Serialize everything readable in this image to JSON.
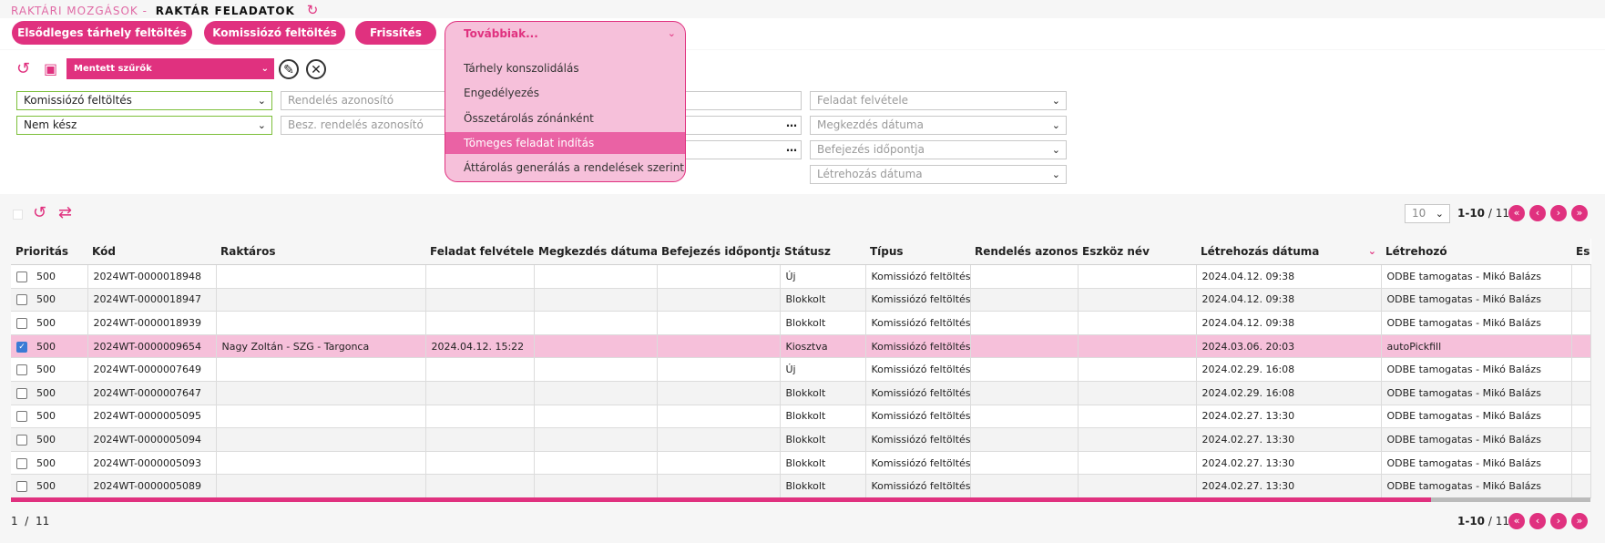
{
  "breadcrumb": {
    "parent": "RAKTÁRI MOZGÁSOK -",
    "current": "RAKTÁR FELADATOK",
    "refresh_icon": "refresh-icon"
  },
  "toolbar": {
    "primary_fill": "Elsődleges tárhely feltöltés",
    "picker_fill": "Komissiózó feltöltés",
    "refresh": "Frissítés"
  },
  "more_menu": {
    "title": "Továbbiak...",
    "items": [
      "Tárhely konszolidálás",
      "Engedélyezés",
      "Összetárolás zónánként",
      "Tömeges feladat indítás",
      "Áttárolás generálás a rendelések szerint"
    ]
  },
  "filters": {
    "saved_filters": "Mentett szűrők",
    "type_value": "Komissiózó feltöltés",
    "status_value": "Nem kész",
    "order_id_placeholder": "Rendelés azonosító",
    "purchase_order_placeholder": "Besz. rendelés azonosító",
    "task_received": "Feladat felvétele",
    "start_date": "Megkezdés dátuma",
    "finish_date": "Befejezés időpontja",
    "created_date": "Létrehozás dátuma"
  },
  "pagination": {
    "page_size": "10",
    "range": "1-10",
    "total": "/ 11",
    "page": "1",
    "page_sep": "/",
    "page_total": "11"
  },
  "columns": [
    "Prioritás",
    "Kód",
    "Raktáros",
    "Feladat felvétele",
    "Megkezdés dátuma",
    "Befejezés időpontja",
    "Státusz",
    "Típus",
    "Rendelés azonosító",
    "Eszköz név",
    "Létrehozás dátuma",
    "Létrehozó",
    "Es"
  ],
  "rows": [
    {
      "checked": false,
      "priority": "500",
      "code": "2024WT-0000018948",
      "worker": "",
      "received": "",
      "started": "",
      "finished": "",
      "status": "Új",
      "type": "Komissiózó feltöltés",
      "order": "",
      "device": "",
      "created": "2024.04.12. 09:38",
      "creator": "ODBE tamogatas - Mikó Balázs"
    },
    {
      "checked": false,
      "priority": "500",
      "code": "2024WT-0000018947",
      "worker": "",
      "received": "",
      "started": "",
      "finished": "",
      "status": "Blokkolt",
      "type": "Komissiózó feltöltés",
      "order": "",
      "device": "",
      "created": "2024.04.12. 09:38",
      "creator": "ODBE tamogatas - Mikó Balázs"
    },
    {
      "checked": false,
      "priority": "500",
      "code": "2024WT-0000018939",
      "worker": "",
      "received": "",
      "started": "",
      "finished": "",
      "status": "Blokkolt",
      "type": "Komissiózó feltöltés",
      "order": "",
      "device": "",
      "created": "2024.04.12. 09:38",
      "creator": "ODBE tamogatas - Mikó Balázs"
    },
    {
      "checked": true,
      "priority": "500",
      "code": "2024WT-0000009654",
      "worker": "Nagy Zoltán - SZG - Targonca",
      "received": "2024.04.12. 15:22",
      "started": "",
      "finished": "",
      "status": "Kiosztva",
      "type": "Komissiózó feltöltés",
      "order": "",
      "device": "",
      "created": "2024.03.06. 20:03",
      "creator": "autoPickfill"
    },
    {
      "checked": false,
      "priority": "500",
      "code": "2024WT-0000007649",
      "worker": "",
      "received": "",
      "started": "",
      "finished": "",
      "status": "Új",
      "type": "Komissiózó feltöltés",
      "order": "",
      "device": "",
      "created": "2024.02.29. 16:08",
      "creator": "ODBE tamogatas - Mikó Balázs"
    },
    {
      "checked": false,
      "priority": "500",
      "code": "2024WT-0000007647",
      "worker": "",
      "received": "",
      "started": "",
      "finished": "",
      "status": "Blokkolt",
      "type": "Komissiózó feltöltés",
      "order": "",
      "device": "",
      "created": "2024.02.29. 16:08",
      "creator": "ODBE tamogatas - Mikó Balázs"
    },
    {
      "checked": false,
      "priority": "500",
      "code": "2024WT-0000005095",
      "worker": "",
      "received": "",
      "started": "",
      "finished": "",
      "status": "Blokkolt",
      "type": "Komissiózó feltöltés",
      "order": "",
      "device": "",
      "created": "2024.02.27. 13:30",
      "creator": "ODBE tamogatas - Mikó Balázs"
    },
    {
      "checked": false,
      "priority": "500",
      "code": "2024WT-0000005094",
      "worker": "",
      "received": "",
      "started": "",
      "finished": "",
      "status": "Blokkolt",
      "type": "Komissiózó feltöltés",
      "order": "",
      "device": "",
      "created": "2024.02.27. 13:30",
      "creator": "ODBE tamogatas - Mikó Balázs"
    },
    {
      "checked": false,
      "priority": "500",
      "code": "2024WT-0000005093",
      "worker": "",
      "received": "",
      "started": "",
      "finished": "",
      "status": "Blokkolt",
      "type": "Komissiózó feltöltés",
      "order": "",
      "device": "",
      "created": "2024.02.27. 13:30",
      "creator": "ODBE tamogatas - Mikó Balázs"
    },
    {
      "checked": false,
      "priority": "500",
      "code": "2024WT-0000005089",
      "worker": "",
      "received": "",
      "started": "",
      "finished": "",
      "status": "Blokkolt",
      "type": "Komissiózó feltöltés",
      "order": "",
      "device": "",
      "created": "2024.02.27. 13:30",
      "creator": "ODBE tamogatas - Mikó Balázs"
    }
  ],
  "colors": {
    "accent": "#e0317f",
    "selected_row": "#f6c0da",
    "valid_border": "#7cbf3a"
  }
}
